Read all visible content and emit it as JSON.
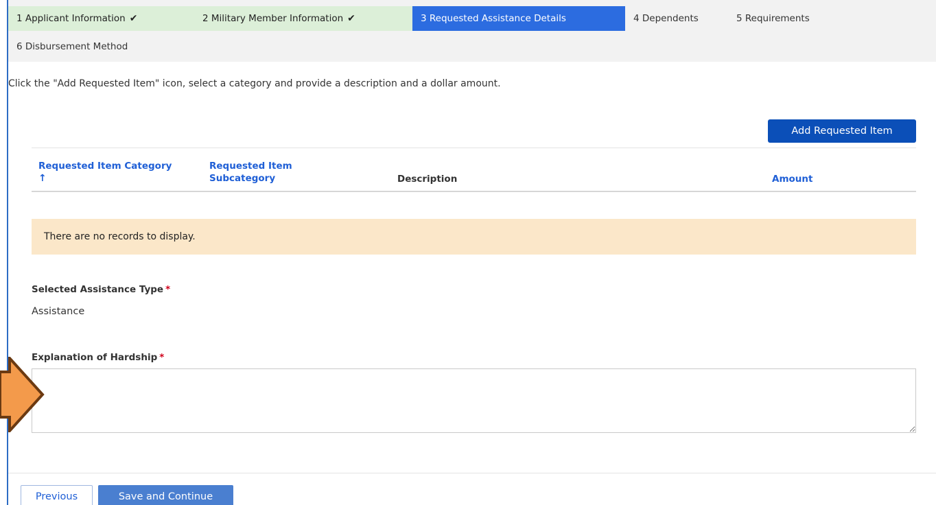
{
  "steps": [
    {
      "label": "1 Applicant Information",
      "status": "done"
    },
    {
      "label": "2 Military Member Information",
      "status": "done"
    },
    {
      "label": "3 Requested Assistance Details",
      "status": "active"
    },
    {
      "label": "4 Dependents",
      "status": "pending"
    },
    {
      "label": "5 Requirements",
      "status": "pending"
    },
    {
      "label": "6 Disbursement Method",
      "status": "pending"
    }
  ],
  "check_glyph": "✔",
  "instructions": "Click the \"Add Requested Item\" icon, select a category and provide a description and a dollar amount.",
  "add_button": "Add Requested Item",
  "table": {
    "headers": {
      "category": "Requested Item Category",
      "subcategory": "Requested Item Subcategory",
      "description": "Description",
      "amount": "Amount"
    },
    "sort_glyph": "↑",
    "empty_message": "There are no records to display."
  },
  "assistance_type": {
    "label": "Selected Assistance Type",
    "value": "Assistance",
    "required_mark": "*"
  },
  "hardship": {
    "label": "Explanation of Hardship",
    "required_mark": "*",
    "value": ""
  },
  "footer": {
    "previous": "Previous",
    "save": "Save and Continue"
  },
  "colors": {
    "accent": "#2c6ce0",
    "done_step": "#dcefd8",
    "empty_bg": "#fbe7c9",
    "annotation_arrow": "#f39a4b"
  }
}
